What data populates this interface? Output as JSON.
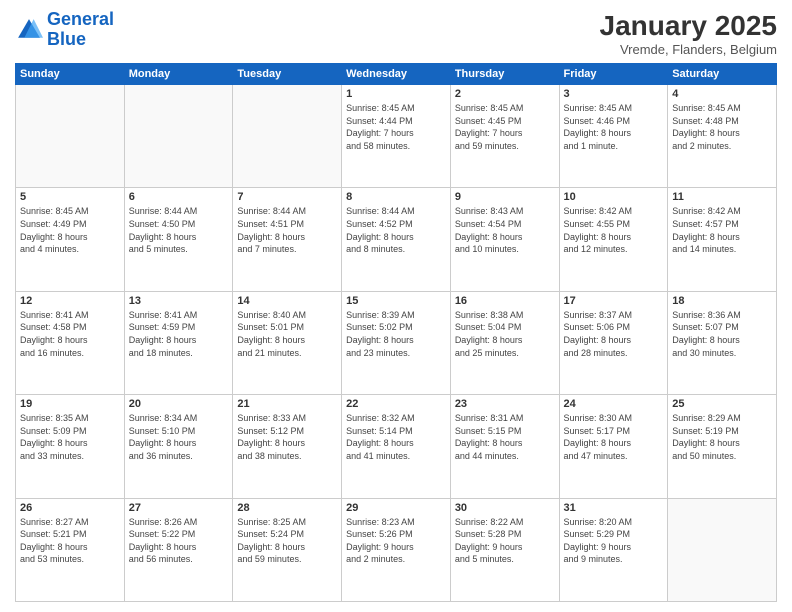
{
  "header": {
    "logo_line1": "General",
    "logo_line2": "Blue",
    "month": "January 2025",
    "location": "Vremde, Flanders, Belgium"
  },
  "weekdays": [
    "Sunday",
    "Monday",
    "Tuesday",
    "Wednesday",
    "Thursday",
    "Friday",
    "Saturday"
  ],
  "weeks": [
    [
      {
        "day": "",
        "info": ""
      },
      {
        "day": "",
        "info": ""
      },
      {
        "day": "",
        "info": ""
      },
      {
        "day": "1",
        "info": "Sunrise: 8:45 AM\nSunset: 4:44 PM\nDaylight: 7 hours\nand 58 minutes."
      },
      {
        "day": "2",
        "info": "Sunrise: 8:45 AM\nSunset: 4:45 PM\nDaylight: 7 hours\nand 59 minutes."
      },
      {
        "day": "3",
        "info": "Sunrise: 8:45 AM\nSunset: 4:46 PM\nDaylight: 8 hours\nand 1 minute."
      },
      {
        "day": "4",
        "info": "Sunrise: 8:45 AM\nSunset: 4:48 PM\nDaylight: 8 hours\nand 2 minutes."
      }
    ],
    [
      {
        "day": "5",
        "info": "Sunrise: 8:45 AM\nSunset: 4:49 PM\nDaylight: 8 hours\nand 4 minutes."
      },
      {
        "day": "6",
        "info": "Sunrise: 8:44 AM\nSunset: 4:50 PM\nDaylight: 8 hours\nand 5 minutes."
      },
      {
        "day": "7",
        "info": "Sunrise: 8:44 AM\nSunset: 4:51 PM\nDaylight: 8 hours\nand 7 minutes."
      },
      {
        "day": "8",
        "info": "Sunrise: 8:44 AM\nSunset: 4:52 PM\nDaylight: 8 hours\nand 8 minutes."
      },
      {
        "day": "9",
        "info": "Sunrise: 8:43 AM\nSunset: 4:54 PM\nDaylight: 8 hours\nand 10 minutes."
      },
      {
        "day": "10",
        "info": "Sunrise: 8:42 AM\nSunset: 4:55 PM\nDaylight: 8 hours\nand 12 minutes."
      },
      {
        "day": "11",
        "info": "Sunrise: 8:42 AM\nSunset: 4:57 PM\nDaylight: 8 hours\nand 14 minutes."
      }
    ],
    [
      {
        "day": "12",
        "info": "Sunrise: 8:41 AM\nSunset: 4:58 PM\nDaylight: 8 hours\nand 16 minutes."
      },
      {
        "day": "13",
        "info": "Sunrise: 8:41 AM\nSunset: 4:59 PM\nDaylight: 8 hours\nand 18 minutes."
      },
      {
        "day": "14",
        "info": "Sunrise: 8:40 AM\nSunset: 5:01 PM\nDaylight: 8 hours\nand 21 minutes."
      },
      {
        "day": "15",
        "info": "Sunrise: 8:39 AM\nSunset: 5:02 PM\nDaylight: 8 hours\nand 23 minutes."
      },
      {
        "day": "16",
        "info": "Sunrise: 8:38 AM\nSunset: 5:04 PM\nDaylight: 8 hours\nand 25 minutes."
      },
      {
        "day": "17",
        "info": "Sunrise: 8:37 AM\nSunset: 5:06 PM\nDaylight: 8 hours\nand 28 minutes."
      },
      {
        "day": "18",
        "info": "Sunrise: 8:36 AM\nSunset: 5:07 PM\nDaylight: 8 hours\nand 30 minutes."
      }
    ],
    [
      {
        "day": "19",
        "info": "Sunrise: 8:35 AM\nSunset: 5:09 PM\nDaylight: 8 hours\nand 33 minutes."
      },
      {
        "day": "20",
        "info": "Sunrise: 8:34 AM\nSunset: 5:10 PM\nDaylight: 8 hours\nand 36 minutes."
      },
      {
        "day": "21",
        "info": "Sunrise: 8:33 AM\nSunset: 5:12 PM\nDaylight: 8 hours\nand 38 minutes."
      },
      {
        "day": "22",
        "info": "Sunrise: 8:32 AM\nSunset: 5:14 PM\nDaylight: 8 hours\nand 41 minutes."
      },
      {
        "day": "23",
        "info": "Sunrise: 8:31 AM\nSunset: 5:15 PM\nDaylight: 8 hours\nand 44 minutes."
      },
      {
        "day": "24",
        "info": "Sunrise: 8:30 AM\nSunset: 5:17 PM\nDaylight: 8 hours\nand 47 minutes."
      },
      {
        "day": "25",
        "info": "Sunrise: 8:29 AM\nSunset: 5:19 PM\nDaylight: 8 hours\nand 50 minutes."
      }
    ],
    [
      {
        "day": "26",
        "info": "Sunrise: 8:27 AM\nSunset: 5:21 PM\nDaylight: 8 hours\nand 53 minutes."
      },
      {
        "day": "27",
        "info": "Sunrise: 8:26 AM\nSunset: 5:22 PM\nDaylight: 8 hours\nand 56 minutes."
      },
      {
        "day": "28",
        "info": "Sunrise: 8:25 AM\nSunset: 5:24 PM\nDaylight: 8 hours\nand 59 minutes."
      },
      {
        "day": "29",
        "info": "Sunrise: 8:23 AM\nSunset: 5:26 PM\nDaylight: 9 hours\nand 2 minutes."
      },
      {
        "day": "30",
        "info": "Sunrise: 8:22 AM\nSunset: 5:28 PM\nDaylight: 9 hours\nand 5 minutes."
      },
      {
        "day": "31",
        "info": "Sunrise: 8:20 AM\nSunset: 5:29 PM\nDaylight: 9 hours\nand 9 minutes."
      },
      {
        "day": "",
        "info": ""
      }
    ]
  ]
}
